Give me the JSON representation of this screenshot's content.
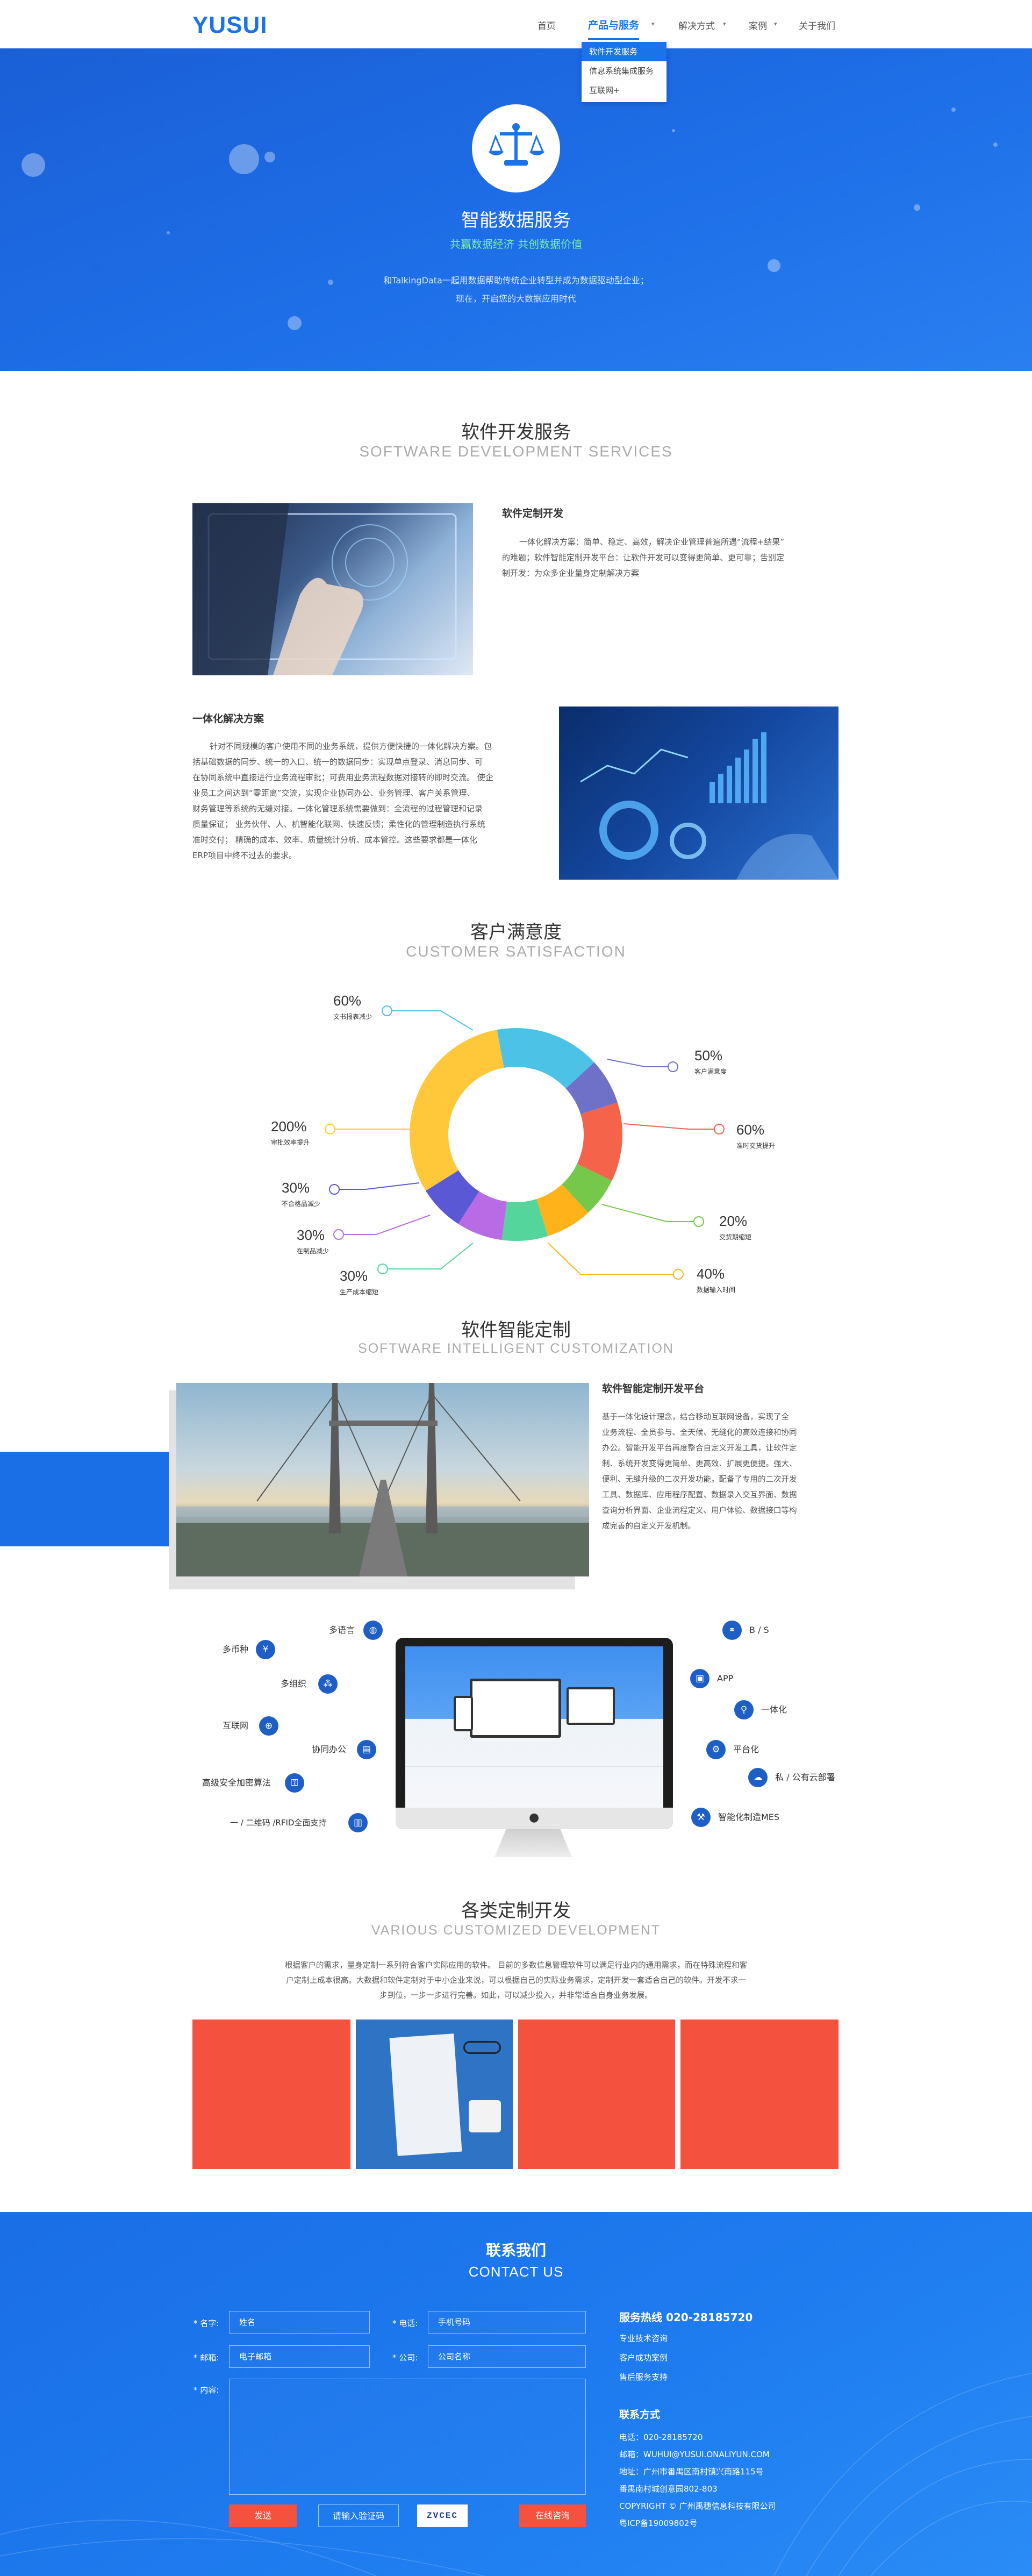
{
  "header": {
    "logo": "YUSUI",
    "nav": [
      "首页",
      "产品与服务",
      "解决方式",
      "案例",
      "关于我们"
    ],
    "dropdown": [
      "软件开发服务",
      "信息系统集成服务",
      "互联网+"
    ]
  },
  "hero": {
    "title": "智能数据服务",
    "subtitle": "共赢数据经济  共创数据价值",
    "desc1": "和TalkingData一起用数据帮助传统企业转型并成为数据驱动型企业；",
    "desc2": "现在，开启您的大数据应用时代"
  },
  "dev": {
    "title": "软件开发服务",
    "en": "SOFTWARE DEVELOPMENT SERVICES",
    "p1_title": "软件定制开发",
    "p1_lines": [
      "一体化解决方案：简单、稳定、高效，解决企业管理普遍所遇“流程+结果”",
      "的难题；软件智能定制开发平台：让软件开发可以变得更简单、更可靠；告别定",
      "制开发：为众多企业量身定制解决方案"
    ],
    "p2_title": "一体化解决方案",
    "p2_lines": [
      "针对不同规模的客户使用不同的业务系统，提供方便快捷的一体化解决方案。包",
      "括基础数据的同步、统一的入口、统一的数据同步：实现单点登录、消息同步、可",
      "在协同系统中直接进行业务流程审批；可费用业务流程数据对接转的即时交流。 使企",
      "业员工之间达到“零距离”交流，实现企业协同办公、业务管理、客户关系管理、",
      "财务管理等系统的无缝对接。一体化管理系统需要做到：全流程的过程管理和记录",
      "质量保证； 业务伙伴、人、机智能化联网、快速反馈；柔性化的管理制造执行系统",
      "准时交付； 精确的成本、效率、质量统计分析、成本管控。这些要求都是一体化",
      "ERP项目中终不过去的要求。"
    ]
  },
  "satisfaction": {
    "title": "客户满意度",
    "en": "CUSTOMER SATISFACTION"
  },
  "chart_data": {
    "type": "pie",
    "series": [
      {
        "values": [
          16,
          7,
          12,
          6,
          7,
          7,
          7,
          7,
          16,
          15
        ]
      }
    ],
    "colors": [
      "#4cc2e6",
      "#6f71c9",
      "#f4634a",
      "#76c84a",
      "#ffb21a",
      "#54d59b",
      "#b86be4",
      "#5b58d6",
      "#ffc83a",
      "#ffc83a"
    ],
    "labels": [
      {
        "pct": "60%",
        "name": "文书报表减少"
      },
      {
        "pct": "50%",
        "name": "客户满意度"
      },
      {
        "pct": "60%",
        "name": "准时交货提升"
      },
      {
        "pct": "20%",
        "name": "交货期缩短"
      },
      {
        "pct": "40%",
        "name": "数据输入时间"
      },
      {
        "pct": "30%",
        "name": "生产成本缩短"
      },
      {
        "pct": "30%",
        "name": "在制品减少"
      },
      {
        "pct": "30%",
        "name": "不合格品减少"
      },
      {
        "pct": "200%",
        "name": "审批效率提升"
      }
    ]
  },
  "smart": {
    "title": "软件智能定制",
    "en": "SOFTWARE INTELLIGENT CUSTOMIZATION",
    "p_title": "软件智能定制开发平台",
    "p_lines": [
      "基于一体化设计理念，结合移动互联网设备，实现了全",
      "业务流程、全员参与、全天候、无缝化的高效连接和协同",
      "办公。智能开发平台再度整合自定义开发工具，让软件定",
      "制、系统开发变得更简单、更高效、扩展更便捷。强大、",
      "便利、无缝升级的二次开发功能，配备了专用的二次开发",
      "工具、数据库、应用程序配置、数据录入交互界面、数据",
      "查询分析界面、企业流程定义、用户体验、数据接口等构",
      "成完善的自定义开发机制。"
    ],
    "left": [
      "多语言",
      "多币种",
      "多组织",
      "互联网",
      "协同办公",
      "高级安全加密算法",
      "一 / 二维码 /RFID全面支持"
    ],
    "right": [
      "B / S",
      "APP",
      "一体化",
      "平台化",
      "私 / 公有云部署",
      "智能化制造MES"
    ]
  },
  "custom": {
    "title": "各类定制开发",
    "en": "VARIOUS CUSTOMIZED DEVELOPMENT",
    "lines": [
      "根据客户的需求，量身定制一系列符合客户实际应用的软件。 目前的多数信息管理软件可以满足行业内的通用需求，而在特殊流程和客",
      "户定制上成本很高。大数据和软件定制对于中小企业来说，可以根据自己的实际业务需求，定制开发一套适合自己的软件。开发不求一",
      "步到位，一步一步进行完善。如此，可以减少投入，并非常适合自身业务发展。"
    ]
  },
  "contact": {
    "title": "联系我们",
    "en": "CONTACT US",
    "name_label": "* 名字:",
    "name_ph": "姓名",
    "phone_label": "* 电话:",
    "phone_ph": "手机号码",
    "email_label": "* 邮箱:",
    "email_ph": "电子邮箱",
    "company_label": "* 公司:",
    "company_ph": "公司名称",
    "content_label": "* 内容:",
    "send": "发送",
    "captcha_ph": "请输入验证码",
    "captcha": "ZVCEC",
    "online": "在线咨询",
    "hotline": "服务热线 020-28185720",
    "links": [
      "专业技术咨询",
      "客户成功案例",
      "售后服务支持"
    ],
    "info_title": "联系方式",
    "info": [
      "电话：020-28185720",
      "邮箱：WUHUI@YUSUI.ONALIYUN.COM",
      "地址：广州市番禺区南村镇兴南路115号",
      "番禺南村城创意园802-803",
      "COPYRIGHT © 广州禹穗信息科技有限公司",
      "粤ICP备19009802号"
    ]
  }
}
